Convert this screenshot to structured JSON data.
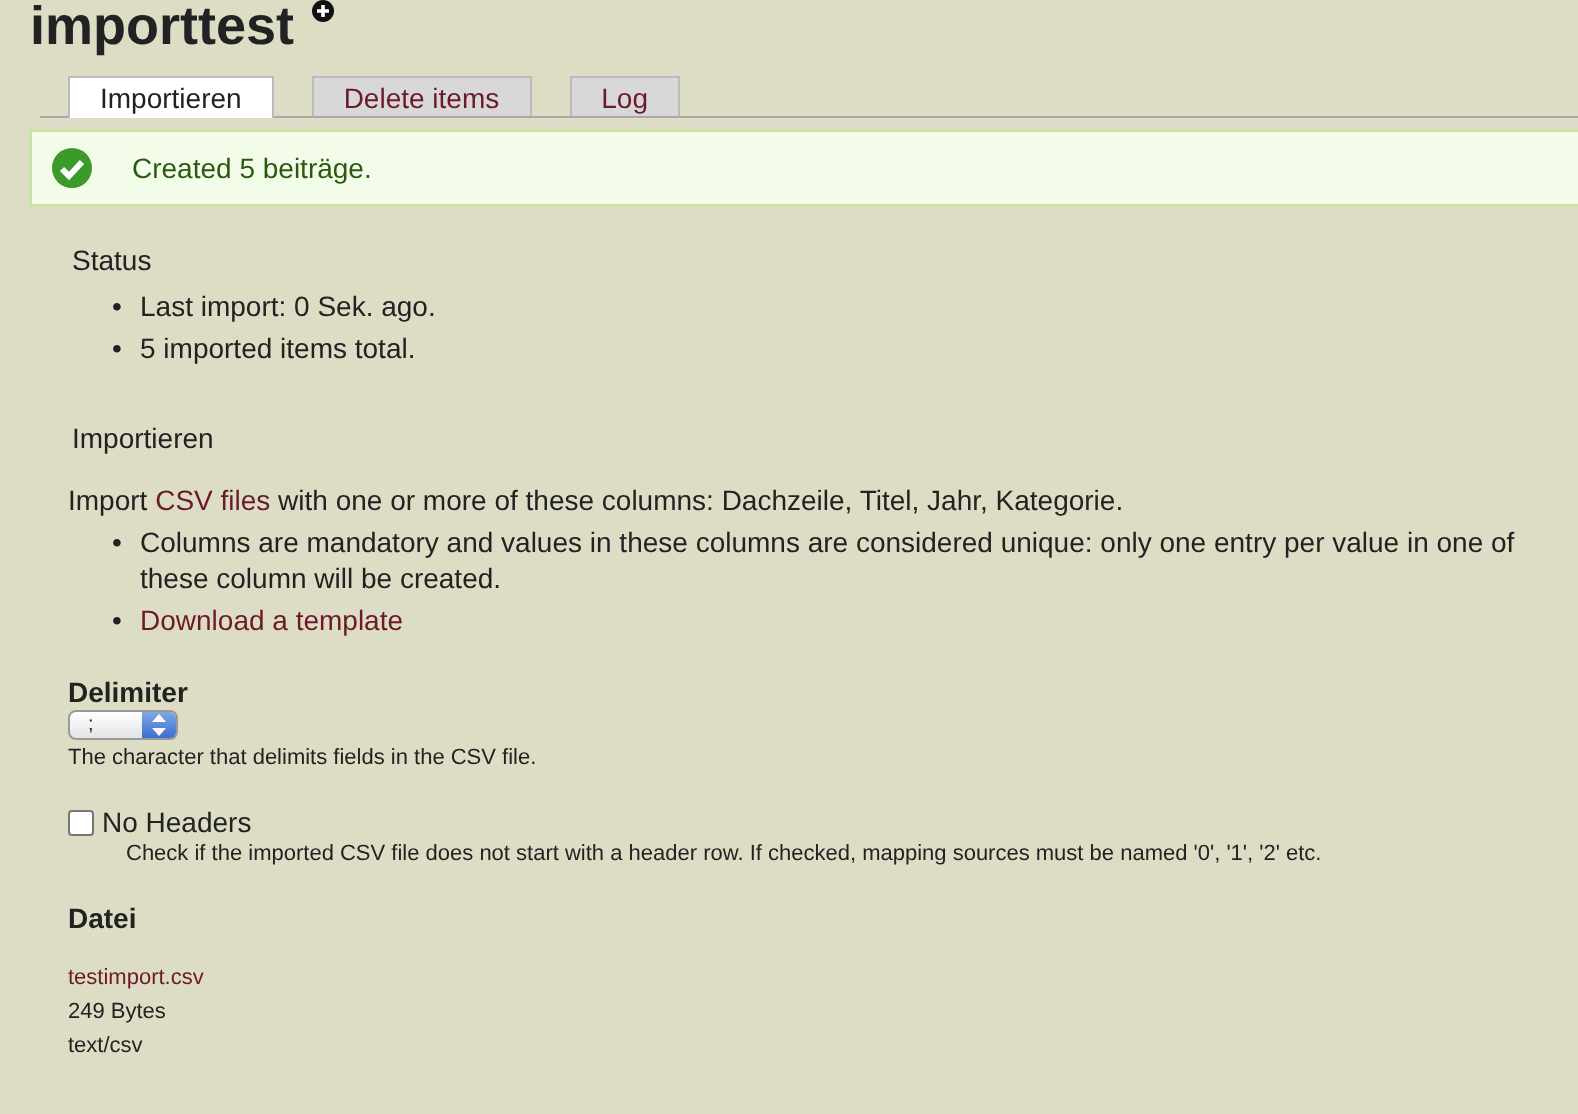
{
  "title": "importtest",
  "tabs": [
    {
      "label": "Importieren",
      "selected": true
    },
    {
      "label": "Delete items",
      "selected": false
    },
    {
      "label": "Log",
      "selected": false
    }
  ],
  "message": {
    "kind": "success",
    "text": "Created 5 beiträge."
  },
  "status": {
    "heading": "Status",
    "items": [
      {
        "bullet": "•",
        "text": "Last import: 0 Sek. ago."
      },
      {
        "bullet": "•",
        "text": "5 imported items total."
      }
    ]
  },
  "import": {
    "heading": "Importieren",
    "intro_before": "Import ",
    "intro_link": "CSV files",
    "intro_after": " with one or more of these columns: Dachzeile, Titel, Jahr, Kategorie.",
    "items": [
      {
        "kind": "text",
        "bullet": "•",
        "text": "Columns are mandatory and values in these columns are considered unique: only one entry per value in one of these column will be created."
      },
      {
        "kind": "link",
        "bullet": "•",
        "text": "Download a template"
      }
    ]
  },
  "delimiter": {
    "label": "Delimiter",
    "value": ";",
    "description": "The character that delimits fields in the CSV file."
  },
  "no_headers": {
    "label": "No Headers",
    "checked": false,
    "description": "Check if the imported CSV file does not start with a header row. If checked, mapping sources must be named '0', '1', '2' etc."
  },
  "file": {
    "label": "Datei",
    "name": "testimport.csv",
    "size": "249 Bytes",
    "type": "text/csv"
  }
}
